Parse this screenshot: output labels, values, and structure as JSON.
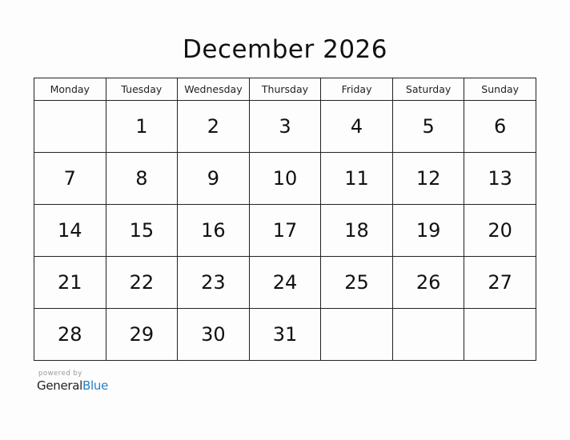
{
  "title": "December 2026",
  "weekdays": [
    "Monday",
    "Tuesday",
    "Wednesday",
    "Thursday",
    "Friday",
    "Saturday",
    "Sunday"
  ],
  "weeks": [
    [
      "",
      "1",
      "2",
      "3",
      "4",
      "5",
      "6"
    ],
    [
      "7",
      "8",
      "9",
      "10",
      "11",
      "12",
      "13"
    ],
    [
      "14",
      "15",
      "16",
      "17",
      "18",
      "19",
      "20"
    ],
    [
      "21",
      "22",
      "23",
      "24",
      "25",
      "26",
      "27"
    ],
    [
      "28",
      "29",
      "30",
      "31",
      "",
      "",
      ""
    ]
  ],
  "footer": {
    "powered_by": "powered by",
    "brand_part1": "General",
    "brand_part2": "Blue",
    "brand_color": "#2a7fc1"
  }
}
